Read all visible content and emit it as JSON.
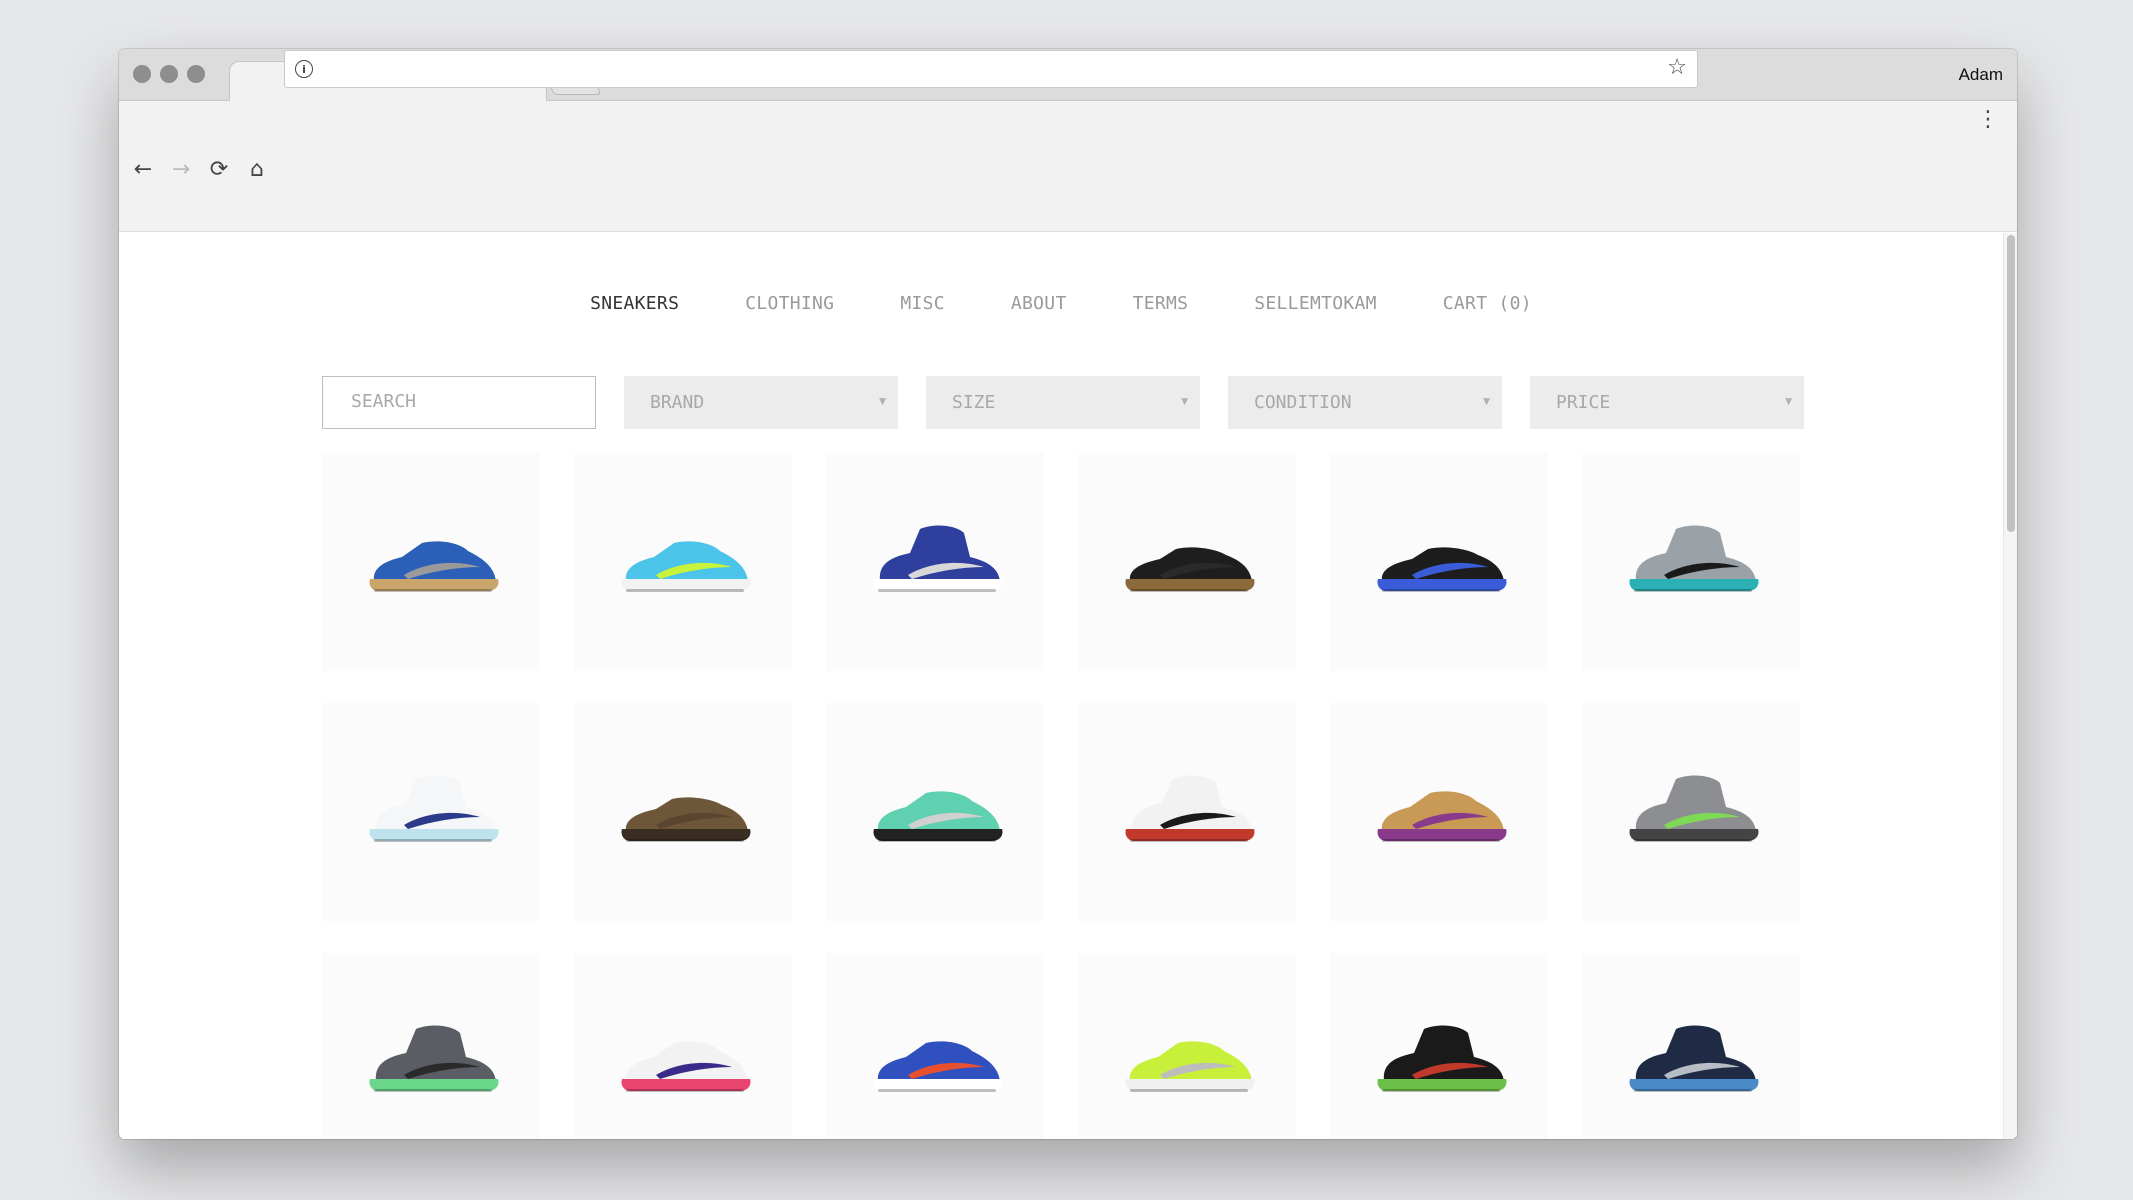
{
  "browser": {
    "user": "Adam",
    "tab_close": "×",
    "address": ""
  },
  "nav": {
    "items": [
      "SNEAKERS",
      "CLOTHING",
      "MISC",
      "ABOUT",
      "TERMS",
      "SELLEMTOKAM",
      "CART (0)"
    ],
    "active": "SNEAKERS"
  },
  "filters": {
    "search_placeholder": "SEARCH",
    "brand": "BRAND",
    "size": "SIZE",
    "condition": "CONDITION",
    "price": "PRICE"
  },
  "products": [
    {
      "upper": "#2b5fb8",
      "accent": "#9a9a9a",
      "sole": "#c9a56b",
      "style": "runner"
    },
    {
      "upper": "#4cc4ea",
      "accent": "#c9f23a",
      "sole": "#f2f2f2",
      "style": "runner"
    },
    {
      "upper": "#2f3f9e",
      "accent": "#d8d8d8",
      "sole": "#ffffff",
      "style": "high"
    },
    {
      "upper": "#1e1e1e",
      "accent": "#2a2a2a",
      "sole": "#8a6a3a",
      "style": "low"
    },
    {
      "upper": "#1d1d1d",
      "accent": "#3a5cd8",
      "sole": "#3a5cd8",
      "style": "low"
    },
    {
      "upper": "#9aa2a8",
      "accent": "#1a1a1a",
      "sole": "#2ab0b5",
      "style": "high"
    },
    {
      "upper": "#f4f6f8",
      "accent": "#2b3a8a",
      "sole": "#bfe3ee",
      "style": "high"
    },
    {
      "upper": "#6e5638",
      "accent": "#5a4630",
      "sole": "#3a2e22",
      "style": "low"
    },
    {
      "upper": "#5fd0b0",
      "accent": "#d0d0d0",
      "sole": "#222222",
      "style": "runner"
    },
    {
      "upper": "#f2f2f2",
      "accent": "#1a1a1a",
      "sole": "#c0392b",
      "style": "high"
    },
    {
      "upper": "#c99a55",
      "accent": "#8a3a8a",
      "sole": "#8a3a8a",
      "style": "runner"
    },
    {
      "upper": "#8c8e92",
      "accent": "#7ed957",
      "sole": "#444444",
      "style": "high"
    },
    {
      "upper": "#5a5e64",
      "accent": "#2a2a2a",
      "sole": "#6ad68a",
      "style": "high"
    },
    {
      "upper": "#f2f2f2",
      "accent": "#3a2a8a",
      "sole": "#e8456f",
      "style": "runner"
    },
    {
      "upper": "#3050c0",
      "accent": "#e85030",
      "sole": "#ffffff",
      "style": "runner"
    },
    {
      "upper": "#c8f03a",
      "accent": "#bdbdbd",
      "sole": "#f0f0f0",
      "style": "runner"
    },
    {
      "upper": "#1a1a1a",
      "accent": "#c0392b",
      "sole": "#6cc04a",
      "style": "high"
    },
    {
      "upper": "#1f2a44",
      "accent": "#b8bcc4",
      "sole": "#4a8ac8",
      "style": "high"
    }
  ]
}
